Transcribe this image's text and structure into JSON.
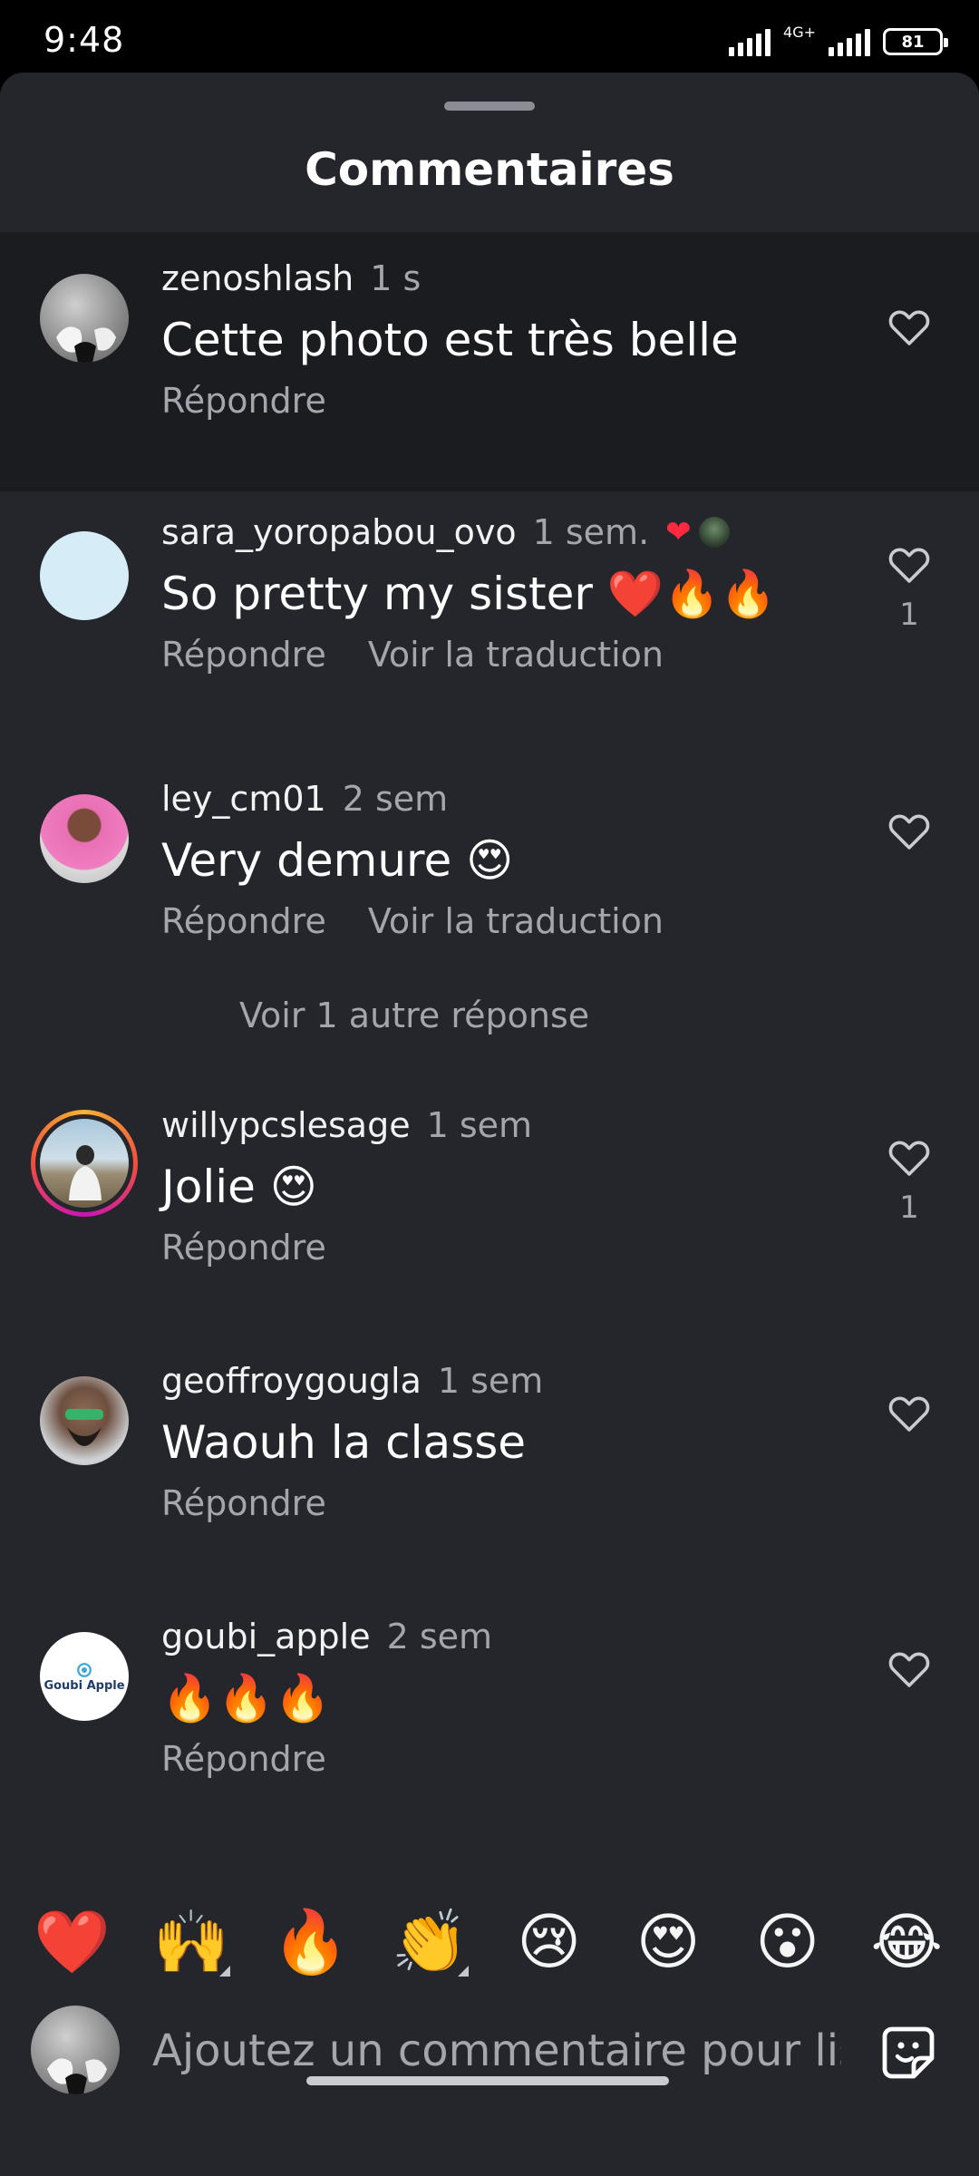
{
  "status_bar": {
    "time": "9:48",
    "network": "4G+",
    "battery": "81"
  },
  "sheet": {
    "title": "Commentaires"
  },
  "comments": [
    {
      "username": "zenoshlash",
      "time": "1 s",
      "text": "Cette photo est très belle",
      "reply": "Répondre",
      "likes": ""
    },
    {
      "username": "sara_yoropabou_ovo",
      "time": "1 sem.",
      "text": "So pretty my sister ❤️🔥🔥",
      "reply": "Répondre",
      "translate": "Voir la traduction",
      "likes": "1"
    },
    {
      "username": "ley_cm01",
      "time": "2 sem",
      "text": "Very demure 😍",
      "reply": "Répondre",
      "translate": "Voir la traduction",
      "more_replies": "Voir 1 autre réponse",
      "likes": ""
    },
    {
      "username": "willypcslesage",
      "time": "1 sem",
      "text": "Jolie 😍",
      "reply": "Répondre",
      "likes": "1"
    },
    {
      "username": "geoffroygougla",
      "time": "1 sem",
      "text": "Waouh la classe",
      "reply": "Répondre",
      "likes": ""
    },
    {
      "username": "goubi_apple",
      "time": "2 sem",
      "text": "🔥🔥🔥",
      "reply": "Répondre",
      "likes": "",
      "avatar_text": "Goubi Apple"
    }
  ],
  "quick_emojis": [
    "❤️",
    "🙌",
    "🔥",
    "👏",
    "😢",
    "😍",
    "😮",
    "😂"
  ],
  "composer": {
    "placeholder": "Ajoutez un commentaire pour lis"
  },
  "colors": {
    "sheet_bg": "#24262b",
    "highlight_bg": "#1b1c20",
    "secondary_text": "#a3a6ad",
    "story_ring_start": "#c913b9",
    "story_ring_end": "#f9b233"
  }
}
